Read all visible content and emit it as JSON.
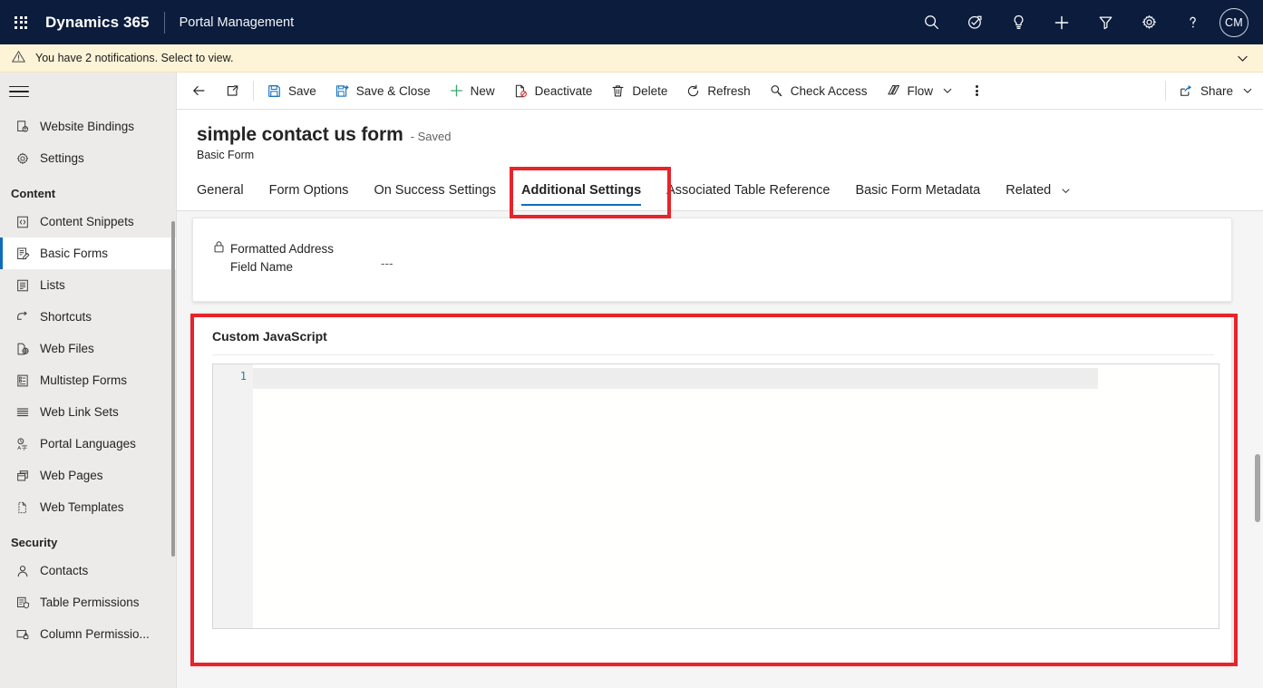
{
  "suite": {
    "waffle": "app-launcher",
    "brand": "Dynamics 365",
    "app_name": "Portal Management",
    "icons": [
      {
        "name": "search-icon",
        "label": "Search"
      },
      {
        "name": "diagnostics-icon",
        "label": "Diagnostics"
      },
      {
        "name": "lightbulb-icon",
        "label": "Ideas"
      },
      {
        "name": "plus-icon",
        "label": "Quick create"
      },
      {
        "name": "filter-icon",
        "label": "Filter"
      },
      {
        "name": "gear-icon",
        "label": "Settings"
      },
      {
        "name": "help-icon",
        "label": "Help"
      }
    ],
    "avatar_initials": "CM"
  },
  "notification": {
    "text": "You have 2 notifications. Select to view.",
    "icon": "warning-icon",
    "expand_icon": "chevron-down-icon",
    "background": "#fdf3d7"
  },
  "sidebar": {
    "menu_icon": "hamburger-icon",
    "items": [
      {
        "label": "Website Bindings",
        "icon": "website-bindings-icon",
        "selected": false
      },
      {
        "label": "Settings",
        "icon": "gear-icon",
        "selected": false
      }
    ],
    "groups": [
      {
        "title": "Content",
        "items": [
          {
            "label": "Content Snippets",
            "icon": "content-snippets-icon",
            "selected": false
          },
          {
            "label": "Basic Forms",
            "icon": "basic-forms-icon",
            "selected": true
          },
          {
            "label": "Lists",
            "icon": "lists-icon",
            "selected": false
          },
          {
            "label": "Shortcuts",
            "icon": "shortcuts-icon",
            "selected": false
          },
          {
            "label": "Web Files",
            "icon": "web-files-icon",
            "selected": false
          },
          {
            "label": "Multistep Forms",
            "icon": "multistep-forms-icon",
            "selected": false
          },
          {
            "label": "Web Link Sets",
            "icon": "web-link-sets-icon",
            "selected": false
          },
          {
            "label": "Portal Languages",
            "icon": "portal-languages-icon",
            "selected": false
          },
          {
            "label": "Web Pages",
            "icon": "web-pages-icon",
            "selected": false
          },
          {
            "label": "Web Templates",
            "icon": "web-templates-icon",
            "selected": false
          }
        ]
      },
      {
        "title": "Security",
        "items": [
          {
            "label": "Contacts",
            "icon": "contacts-icon",
            "selected": false
          },
          {
            "label": "Table Permissions",
            "icon": "table-permissions-icon",
            "selected": false
          },
          {
            "label": "Column Permissio...",
            "icon": "column-permissions-icon",
            "selected": false
          }
        ]
      }
    ],
    "selection_accent": "#0f6cbd"
  },
  "commandbar": {
    "back_icon": "back-arrow-icon",
    "popout_icon": "open-in-new-window-icon",
    "buttons": [
      {
        "label": "Save",
        "icon": "save-icon"
      },
      {
        "label": "Save & Close",
        "icon": "save-and-close-icon"
      },
      {
        "label": "New",
        "icon": "plus-icon"
      },
      {
        "label": "Deactivate",
        "icon": "deactivate-icon"
      },
      {
        "label": "Delete",
        "icon": "trash-icon"
      },
      {
        "label": "Refresh",
        "icon": "refresh-icon"
      },
      {
        "label": "Check Access",
        "icon": "check-access-icon"
      },
      {
        "label": "Flow",
        "icon": "flow-icon",
        "has_chevron": true
      }
    ],
    "overflow_icon": "more-options-icon",
    "share": {
      "label": "Share",
      "icon": "share-icon",
      "has_chevron": true
    }
  },
  "record": {
    "title": "simple contact us form",
    "status": "- Saved",
    "subtitle": "Basic Form"
  },
  "tabs": [
    {
      "label": "General",
      "active": false
    },
    {
      "label": "Form Options",
      "active": false
    },
    {
      "label": "On Success Settings",
      "active": false
    },
    {
      "label": "Additional Settings",
      "active": true
    },
    {
      "label": "Associated Table Reference",
      "active": false
    },
    {
      "label": "Basic Form Metadata",
      "active": false
    },
    {
      "label": "Related",
      "active": false,
      "has_chevron": true
    }
  ],
  "form": {
    "locked_field": {
      "label_line1": "Formatted Address",
      "label_line2": "Field Name",
      "value": "---",
      "icon": "lock-icon"
    },
    "custom_javascript": {
      "heading": "Custom JavaScript",
      "line_number": "1",
      "code": "",
      "line_number_color": "#2b7ca3"
    }
  },
  "annotations": [
    {
      "name": "annotation-additional-settings-tab",
      "color": "#e8232a"
    },
    {
      "name": "annotation-custom-javascript-section",
      "color": "#e8232a"
    }
  ]
}
